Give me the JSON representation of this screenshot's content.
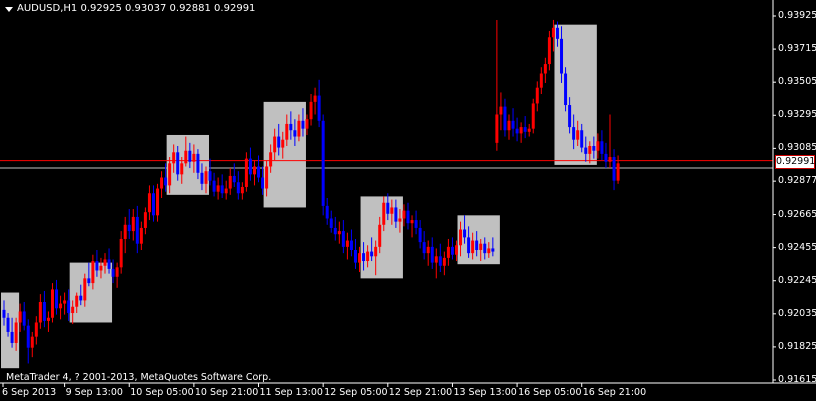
{
  "window": {
    "symbol_line": "AUDUSD,H1  0.92925 0.93037 0.92881 0.92991",
    "copyright": "MetaTrader 4, ? 2001-2013, MetaQuotes Software Corp.",
    "colors": {
      "background": "#000000",
      "axis": "#ffffff",
      "bull": "#ff0000",
      "bear": "#0000ff",
      "session_box": "#c0c0c0",
      "price_line": "#ff0000"
    }
  },
  "price_axis": {
    "labels": [
      "0.93925",
      "0.93715",
      "0.93505",
      "0.93295",
      "0.93085",
      "0.92991",
      "0.92877",
      "0.92665",
      "0.92455",
      "0.92245",
      "0.92035",
      "0.91825",
      "0.91615"
    ],
    "current_price": "0.92991"
  },
  "time_axis": {
    "labels": [
      "6 Sep 2013",
      "9 Sep 13:00",
      "10 Sep 05:00",
      "10 Sep 21:00",
      "11 Sep 13:00",
      "12 Sep 05:00",
      "12 Sep 21:00",
      "13 Sep 13:00",
      "16 Sep 05:00",
      "16 Sep 21:00"
    ]
  },
  "chart_data": {
    "type": "candlestick",
    "title": "AUDUSD,H1",
    "ylim": [
      0.91615,
      0.93925
    ],
    "close_price": 0.92991,
    "horizontal_lines": [
      0.93007,
      0.9296
    ],
    "session_boxes": [
      {
        "from": 0,
        "to": 3,
        "low": 0.9169,
        "high": 0.9217
      },
      {
        "from": 17,
        "to": 26,
        "low": 0.9198,
        "high": 0.9236
      },
      {
        "from": 41,
        "to": 50,
        "low": 0.9279,
        "high": 0.9317
      },
      {
        "from": 65,
        "to": 74,
        "low": 0.9271,
        "high": 0.9338
      },
      {
        "from": 89,
        "to": 98,
        "low": 0.9226,
        "high": 0.9278
      },
      {
        "from": 113,
        "to": 122,
        "low": 0.9235,
        "high": 0.9266
      },
      {
        "from": 137,
        "to": 146,
        "low": 0.9298,
        "high": 0.9387
      }
    ],
    "candles": [
      [
        0.9206,
        0.9212,
        0.9196,
        0.9201
      ],
      [
        0.9201,
        0.9204,
        0.9189,
        0.9192
      ],
      [
        0.9192,
        0.9201,
        0.9182,
        0.9185
      ],
      [
        0.9185,
        0.9201,
        0.918,
        0.9198
      ],
      [
        0.9198,
        0.921,
        0.9192,
        0.9205
      ],
      [
        0.9205,
        0.9211,
        0.9193,
        0.9196
      ],
      [
        0.9196,
        0.92,
        0.9172,
        0.9182
      ],
      [
        0.9182,
        0.9192,
        0.9176,
        0.9189
      ],
      [
        0.9189,
        0.9202,
        0.9184,
        0.9198
      ],
      [
        0.9198,
        0.9216,
        0.9194,
        0.9211
      ],
      [
        0.9211,
        0.9218,
        0.9195,
        0.9199
      ],
      [
        0.9199,
        0.9205,
        0.9192,
        0.9201
      ],
      [
        0.9201,
        0.9223,
        0.9198,
        0.9219
      ],
      [
        0.9219,
        0.9225,
        0.9203,
        0.9207
      ],
      [
        0.9207,
        0.9215,
        0.92,
        0.921
      ],
      [
        0.921,
        0.9217,
        0.9203,
        0.9212
      ],
      [
        0.9212,
        0.9219,
        0.9199,
        0.9204
      ],
      [
        0.9204,
        0.9212,
        0.9197,
        0.9208
      ],
      [
        0.9208,
        0.9217,
        0.9204,
        0.9215
      ],
      [
        0.9215,
        0.9222,
        0.9209,
        0.9212
      ],
      [
        0.9212,
        0.9229,
        0.9208,
        0.9226
      ],
      [
        0.9226,
        0.9236,
        0.9221,
        0.9223
      ],
      [
        0.9223,
        0.9241,
        0.9219,
        0.9237
      ],
      [
        0.9237,
        0.9244,
        0.9227,
        0.9231
      ],
      [
        0.9231,
        0.9239,
        0.9226,
        0.9234
      ],
      [
        0.9234,
        0.9242,
        0.9229,
        0.9238
      ],
      [
        0.9238,
        0.9245,
        0.9229,
        0.9232
      ],
      [
        0.9232,
        0.9238,
        0.9223,
        0.9227
      ],
      [
        0.9227,
        0.9236,
        0.922,
        0.9233
      ],
      [
        0.9233,
        0.9256,
        0.9229,
        0.9251
      ],
      [
        0.9251,
        0.9265,
        0.9242,
        0.926
      ],
      [
        0.926,
        0.927,
        0.9251,
        0.9256
      ],
      [
        0.9256,
        0.927,
        0.925,
        0.9265
      ],
      [
        0.9265,
        0.9272,
        0.9242,
        0.9248
      ],
      [
        0.9248,
        0.9262,
        0.9244,
        0.9258
      ],
      [
        0.9258,
        0.9271,
        0.9254,
        0.9268
      ],
      [
        0.9268,
        0.9285,
        0.9263,
        0.928
      ],
      [
        0.928,
        0.9285,
        0.9262,
        0.9266
      ],
      [
        0.9266,
        0.9286,
        0.9262,
        0.9283
      ],
      [
        0.9283,
        0.9294,
        0.9277,
        0.929
      ],
      [
        0.929,
        0.9299,
        0.9281,
        0.9285
      ],
      [
        0.9285,
        0.9303,
        0.928,
        0.9299
      ],
      [
        0.9299,
        0.9311,
        0.9293,
        0.9306
      ],
      [
        0.9306,
        0.931,
        0.9288,
        0.9292
      ],
      [
        0.9292,
        0.9303,
        0.9286,
        0.9299
      ],
      [
        0.9299,
        0.9316,
        0.9297,
        0.9307
      ],
      [
        0.9307,
        0.9312,
        0.9296,
        0.93
      ],
      [
        0.93,
        0.9311,
        0.9293,
        0.9305
      ],
      [
        0.9305,
        0.9308,
        0.9289,
        0.9293
      ],
      [
        0.9293,
        0.9299,
        0.9282,
        0.9286
      ],
      [
        0.9286,
        0.9297,
        0.928,
        0.9294
      ],
      [
        0.9294,
        0.9302,
        0.9285,
        0.9288
      ],
      [
        0.9288,
        0.9293,
        0.9278,
        0.9281
      ],
      [
        0.9281,
        0.929,
        0.9276,
        0.9285
      ],
      [
        0.9285,
        0.9292,
        0.9277,
        0.928
      ],
      [
        0.928,
        0.9288,
        0.9276,
        0.9283
      ],
      [
        0.9283,
        0.9296,
        0.9279,
        0.9291
      ],
      [
        0.9291,
        0.9299,
        0.9284,
        0.9287
      ],
      [
        0.9287,
        0.9294,
        0.9276,
        0.928
      ],
      [
        0.928,
        0.9287,
        0.9276,
        0.9284
      ],
      [
        0.9284,
        0.9306,
        0.9281,
        0.9302
      ],
      [
        0.9302,
        0.9309,
        0.9288,
        0.9292
      ],
      [
        0.9292,
        0.9301,
        0.9285,
        0.9297
      ],
      [
        0.9297,
        0.9304,
        0.9287,
        0.929
      ],
      [
        0.929,
        0.9297,
        0.9279,
        0.9283
      ],
      [
        0.9283,
        0.9301,
        0.9278,
        0.9297
      ],
      [
        0.9297,
        0.9311,
        0.9293,
        0.9306
      ],
      [
        0.9306,
        0.9321,
        0.9301,
        0.9316
      ],
      [
        0.9316,
        0.9324,
        0.9304,
        0.9309
      ],
      [
        0.9309,
        0.9319,
        0.9302,
        0.9314
      ],
      [
        0.9314,
        0.933,
        0.931,
        0.9324
      ],
      [
        0.9324,
        0.9332,
        0.9314,
        0.932
      ],
      [
        0.932,
        0.9327,
        0.931,
        0.9316
      ],
      [
        0.9316,
        0.933,
        0.9313,
        0.9326
      ],
      [
        0.9326,
        0.9334,
        0.9316,
        0.9321
      ],
      [
        0.9321,
        0.933,
        0.9317,
        0.9327
      ],
      [
        0.9327,
        0.9343,
        0.9323,
        0.9338
      ],
      [
        0.9338,
        0.9347,
        0.933,
        0.9342
      ],
      [
        0.9342,
        0.9352,
        0.9322,
        0.9326
      ],
      [
        0.9326,
        0.933,
        0.9266,
        0.9272
      ],
      [
        0.9272,
        0.9277,
        0.926,
        0.9264
      ],
      [
        0.9264,
        0.9269,
        0.9255,
        0.9258
      ],
      [
        0.9258,
        0.9265,
        0.925,
        0.9254
      ],
      [
        0.9254,
        0.9262,
        0.9248,
        0.9256
      ],
      [
        0.9256,
        0.9263,
        0.9242,
        0.9246
      ],
      [
        0.9246,
        0.9255,
        0.9238,
        0.925
      ],
      [
        0.925,
        0.9257,
        0.924,
        0.9244
      ],
      [
        0.9244,
        0.9251,
        0.9232,
        0.9236
      ],
      [
        0.9236,
        0.9246,
        0.923,
        0.9242
      ],
      [
        0.9242,
        0.9249,
        0.9231,
        0.9237
      ],
      [
        0.9237,
        0.9247,
        0.9233,
        0.9243
      ],
      [
        0.9243,
        0.9252,
        0.9237,
        0.924
      ],
      [
        0.924,
        0.925,
        0.9228,
        0.9246
      ],
      [
        0.9246,
        0.9265,
        0.9242,
        0.926
      ],
      [
        0.926,
        0.9278,
        0.9256,
        0.9274
      ],
      [
        0.9274,
        0.928,
        0.9263,
        0.9267
      ],
      [
        0.9267,
        0.9276,
        0.926,
        0.9271
      ],
      [
        0.9271,
        0.9276,
        0.9258,
        0.9262
      ],
      [
        0.9262,
        0.927,
        0.9255,
        0.9264
      ],
      [
        0.9264,
        0.9273,
        0.9259,
        0.9269
      ],
      [
        0.9269,
        0.9274,
        0.9257,
        0.9261
      ],
      [
        0.9261,
        0.9266,
        0.9252,
        0.9263
      ],
      [
        0.9263,
        0.9269,
        0.9254,
        0.9258
      ],
      [
        0.9258,
        0.9263,
        0.9245,
        0.9249
      ],
      [
        0.9249,
        0.9256,
        0.9238,
        0.9242
      ],
      [
        0.9242,
        0.925,
        0.9234,
        0.9246
      ],
      [
        0.9246,
        0.9252,
        0.9232,
        0.9236
      ],
      [
        0.9236,
        0.9245,
        0.9226,
        0.924
      ],
      [
        0.924,
        0.9248,
        0.923,
        0.9234
      ],
      [
        0.9234,
        0.9243,
        0.9228,
        0.9239
      ],
      [
        0.9239,
        0.9251,
        0.9234,
        0.9246
      ],
      [
        0.9246,
        0.9252,
        0.9238,
        0.9241
      ],
      [
        0.9241,
        0.925,
        0.9237,
        0.9247
      ],
      [
        0.9247,
        0.9262,
        0.924,
        0.9257
      ],
      [
        0.9257,
        0.9266,
        0.9248,
        0.9252
      ],
      [
        0.9252,
        0.9259,
        0.9239,
        0.9242
      ],
      [
        0.9242,
        0.9255,
        0.9238,
        0.925
      ],
      [
        0.925,
        0.9256,
        0.924,
        0.9244
      ],
      [
        0.9244,
        0.9251,
        0.9237,
        0.9248
      ],
      [
        0.9248,
        0.9252,
        0.9238,
        0.9242
      ],
      [
        0.9242,
        0.9249,
        0.9239,
        0.9245
      ],
      [
        0.9245,
        0.9252,
        0.924,
        0.9243
      ],
      [
        0.9312,
        0.939,
        0.9307,
        0.933
      ],
      [
        0.933,
        0.9344,
        0.932,
        0.9335
      ],
      [
        0.9335,
        0.934,
        0.9316,
        0.932
      ],
      [
        0.932,
        0.933,
        0.9314,
        0.9326
      ],
      [
        0.9326,
        0.9334,
        0.9316,
        0.9321
      ],
      [
        0.9321,
        0.9328,
        0.9313,
        0.9318
      ],
      [
        0.9318,
        0.9325,
        0.9312,
        0.9322
      ],
      [
        0.9322,
        0.9329,
        0.9315,
        0.9319
      ],
      [
        0.9319,
        0.9324,
        0.9316,
        0.9321
      ],
      [
        0.9321,
        0.934,
        0.9318,
        0.9337
      ],
      [
        0.9337,
        0.9351,
        0.9332,
        0.9347
      ],
      [
        0.9347,
        0.936,
        0.9343,
        0.9356
      ],
      [
        0.9356,
        0.9366,
        0.935,
        0.9362
      ],
      [
        0.9362,
        0.9383,
        0.9358,
        0.9379
      ],
      [
        0.9379,
        0.939,
        0.937,
        0.9385
      ],
      [
        0.9385,
        0.9389,
        0.9373,
        0.9378
      ],
      [
        0.9378,
        0.9386,
        0.935,
        0.9356
      ],
      [
        0.9356,
        0.936,
        0.9332,
        0.9336
      ],
      [
        0.9336,
        0.9341,
        0.9318,
        0.9322
      ],
      [
        0.9322,
        0.933,
        0.9308,
        0.9314
      ],
      [
        0.9314,
        0.9326,
        0.931,
        0.932
      ],
      [
        0.932,
        0.9324,
        0.9306,
        0.9309
      ],
      [
        0.9309,
        0.9316,
        0.93,
        0.9305
      ],
      [
        0.9305,
        0.9313,
        0.9299,
        0.931
      ],
      [
        0.931,
        0.9316,
        0.9302,
        0.9307
      ],
      [
        0.9307,
        0.9318,
        0.9302,
        0.9313
      ],
      [
        0.9313,
        0.932,
        0.9301,
        0.9305
      ],
      [
        0.9305,
        0.9312,
        0.9296,
        0.93
      ],
      [
        0.93,
        0.933,
        0.9296,
        0.9303
      ],
      [
        0.9303,
        0.9308,
        0.9282,
        0.9288
      ],
      [
        0.9288,
        0.9304,
        0.9286,
        0.9299
      ]
    ]
  }
}
